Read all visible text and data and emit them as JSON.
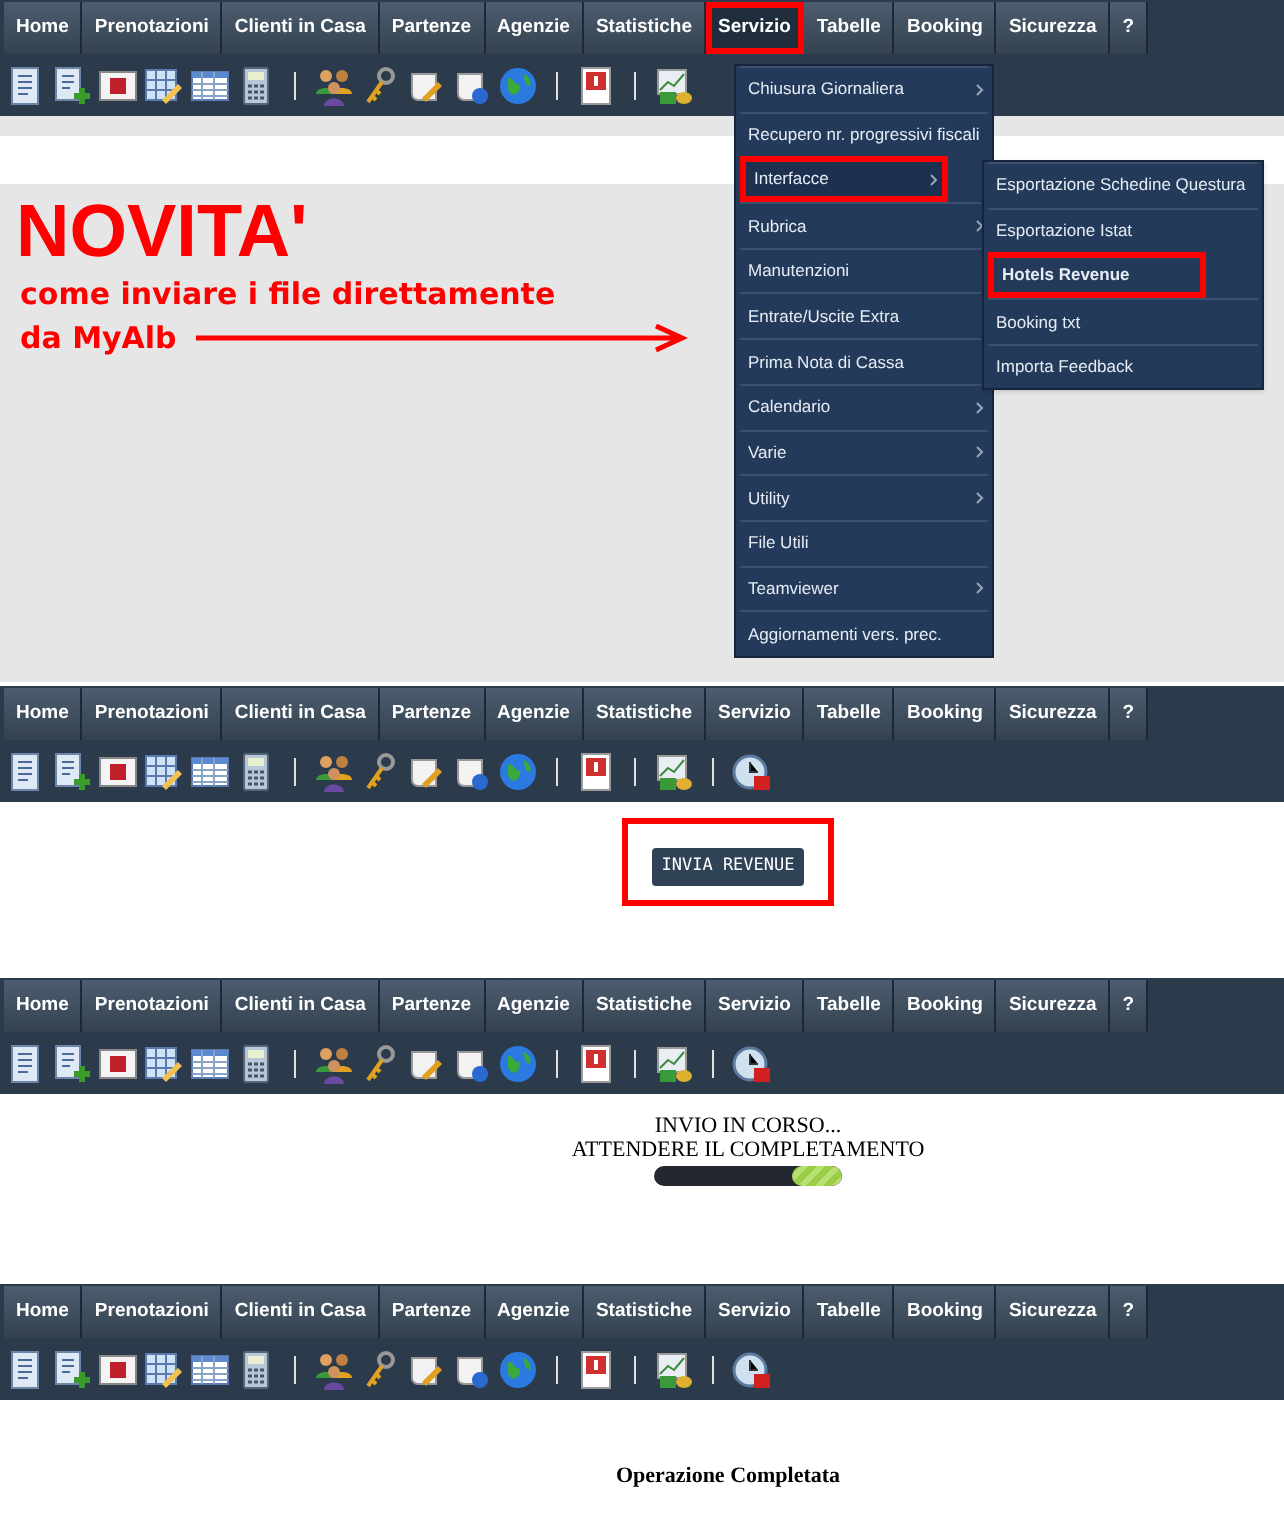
{
  "panels": [
    {
      "nav": [
        {
          "label": "Home",
          "selected": false
        },
        {
          "label": "Prenotazioni",
          "selected": false
        },
        {
          "label": "Clienti in Casa",
          "selected": false
        },
        {
          "label": "Partenze",
          "selected": false
        },
        {
          "label": "Agenzie",
          "selected": false
        },
        {
          "label": "Statistiche",
          "selected": false
        },
        {
          "label": "Servizio",
          "selected": true
        },
        {
          "label": "Tabelle",
          "selected": false
        },
        {
          "label": "Booking",
          "selected": false
        },
        {
          "label": "Sicurezza",
          "selected": false
        },
        {
          "label": "?",
          "selected": false
        }
      ],
      "annotation": {
        "title": "NOVITA'",
        "line_1": "come inviare i file direttamente",
        "line_2": "da MyAlb"
      },
      "menu": {
        "items": [
          {
            "label": "Chiusura Giornaliera",
            "submenu": true,
            "highlighted": false
          },
          {
            "label": "Recupero nr. progressivi fiscali",
            "submenu": false,
            "highlighted": false
          },
          {
            "label": "Interfacce",
            "submenu": true,
            "highlighted": true
          },
          {
            "label": "Rubrica",
            "submenu": true,
            "highlighted": false
          },
          {
            "label": "Manutenzioni",
            "submenu": false,
            "highlighted": false
          },
          {
            "label": "Entrate/Uscite Extra",
            "submenu": false,
            "highlighted": false
          },
          {
            "label": "Prima Nota di Cassa",
            "submenu": false,
            "highlighted": false
          },
          {
            "label": "Calendario",
            "submenu": true,
            "highlighted": false
          },
          {
            "label": "Varie",
            "submenu": true,
            "highlighted": false
          },
          {
            "label": "Utility",
            "submenu": true,
            "highlighted": false
          },
          {
            "label": "File Utili",
            "submenu": false,
            "highlighted": false
          },
          {
            "label": "Teamviewer",
            "submenu": true,
            "highlighted": false
          },
          {
            "label": "Aggiornamenti vers. prec.",
            "submenu": false,
            "highlighted": false
          }
        ],
        "submenu": [
          {
            "label": "Esportazione Schedine Questura",
            "highlighted": false
          },
          {
            "label": "Esportazione Istat",
            "highlighted": false
          },
          {
            "label": "Hotels Revenue",
            "highlighted": true
          },
          {
            "label": "Booking txt",
            "highlighted": false
          },
          {
            "label": "Importa Feedback",
            "highlighted": false
          }
        ]
      }
    },
    {
      "nav": [
        {
          "label": "Home",
          "selected": false
        },
        {
          "label": "Prenotazioni",
          "selected": false
        },
        {
          "label": "Clienti in Casa",
          "selected": false
        },
        {
          "label": "Partenze",
          "selected": false
        },
        {
          "label": "Agenzie",
          "selected": false
        },
        {
          "label": "Statistiche",
          "selected": false
        },
        {
          "label": "Servizio",
          "selected": false
        },
        {
          "label": "Tabelle",
          "selected": false
        },
        {
          "label": "Booking",
          "selected": false
        },
        {
          "label": "Sicurezza",
          "selected": false
        },
        {
          "label": "?",
          "selected": false
        }
      ],
      "button": {
        "label": "INVIA REVENUE",
        "highlighted": true
      }
    },
    {
      "nav": [
        {
          "label": "Home",
          "selected": false
        },
        {
          "label": "Prenotazioni",
          "selected": false
        },
        {
          "label": "Clienti in Casa",
          "selected": false
        },
        {
          "label": "Partenze",
          "selected": false
        },
        {
          "label": "Agenzie",
          "selected": false
        },
        {
          "label": "Statistiche",
          "selected": false
        },
        {
          "label": "Servizio",
          "selected": false
        },
        {
          "label": "Tabelle",
          "selected": false
        },
        {
          "label": "Booking",
          "selected": false
        },
        {
          "label": "Sicurezza",
          "selected": false
        },
        {
          "label": "?",
          "selected": false
        }
      ],
      "progress": {
        "line_1": "INVIO IN CORSO...",
        "line_2": "ATTENDERE IL COMPLETAMENTO",
        "level": 0.27
      }
    },
    {
      "nav": [
        {
          "label": "Home",
          "selected": false
        },
        {
          "label": "Prenotazioni",
          "selected": false
        },
        {
          "label": "Clienti in Casa",
          "selected": false
        },
        {
          "label": "Partenze",
          "selected": false
        },
        {
          "label": "Agenzie",
          "selected": false
        },
        {
          "label": "Statistiche",
          "selected": false
        },
        {
          "label": "Servizio",
          "selected": false
        },
        {
          "label": "Tabelle",
          "selected": false
        },
        {
          "label": "Booking",
          "selected": false
        },
        {
          "label": "Sicurezza",
          "selected": false
        },
        {
          "label": "?",
          "selected": false
        }
      ],
      "message": "Operazione Completata"
    }
  ]
}
